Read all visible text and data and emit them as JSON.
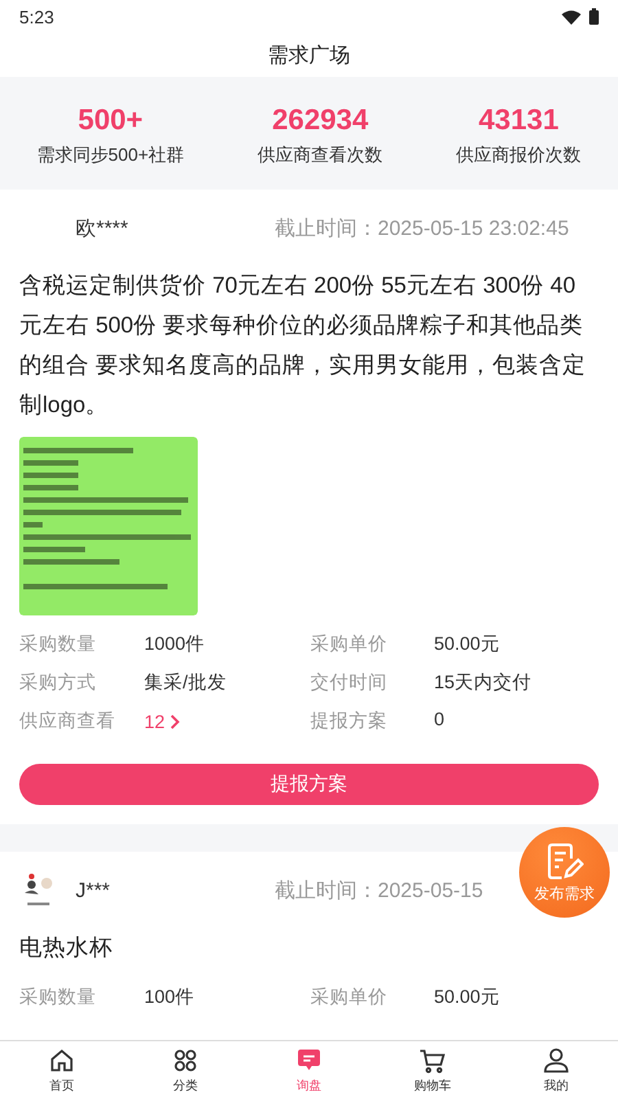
{
  "status_bar": {
    "time": "5:23"
  },
  "header": {
    "title": "需求广场"
  },
  "stats": [
    {
      "value": "500+",
      "label": "需求同步500+社群"
    },
    {
      "value": "262934",
      "label": "供应商查看次数"
    },
    {
      "value": "43131",
      "label": "供应商报价次数"
    }
  ],
  "demands": [
    {
      "user": "欧****",
      "deadline": "截止时间：2025-05-15 23:02:45",
      "description": "含税运定制供货价 70元左右 200份 55元左右 300份 40元左右 500份 要求每种价位的必须品牌粽子和其他品类的组合 要求知名度高的品牌，实用男女能用，包装含定制logo。",
      "attachment": {
        "kind": "picture"
      },
      "details": [
        {
          "label": "采购数量",
          "value": "1000件",
          "kind": "plain"
        },
        {
          "label": "采购单价",
          "value": "50.00元",
          "kind": "plain"
        },
        {
          "label": "采购方式",
          "value": "集采/批发",
          "kind": "plain"
        },
        {
          "label": "交付时间",
          "value": "15天内交付",
          "kind": "plain"
        },
        {
          "label": "供应商查看",
          "value": "12",
          "kind": "link"
        },
        {
          "label": "提报方案",
          "value": "0",
          "kind": "plain"
        }
      ],
      "button": "提报方案"
    },
    {
      "user": "J***",
      "avatar": {
        "kind": "picture"
      },
      "deadline": "截止时间：2025-05-15",
      "description": "电热水杯",
      "details": [
        {
          "label": "采购数量",
          "value": "100件",
          "kind": "plain"
        },
        {
          "label": "采购单价",
          "value": "50.00元",
          "kind": "plain"
        }
      ]
    }
  ],
  "fab": {
    "label": "发布需求"
  },
  "tab_bar": [
    {
      "label": "首页",
      "selected": false
    },
    {
      "label": "分类",
      "selected": false
    },
    {
      "label": "询盘",
      "selected": true
    },
    {
      "label": "购物车",
      "selected": false
    },
    {
      "label": "我的",
      "selected": false
    }
  ]
}
